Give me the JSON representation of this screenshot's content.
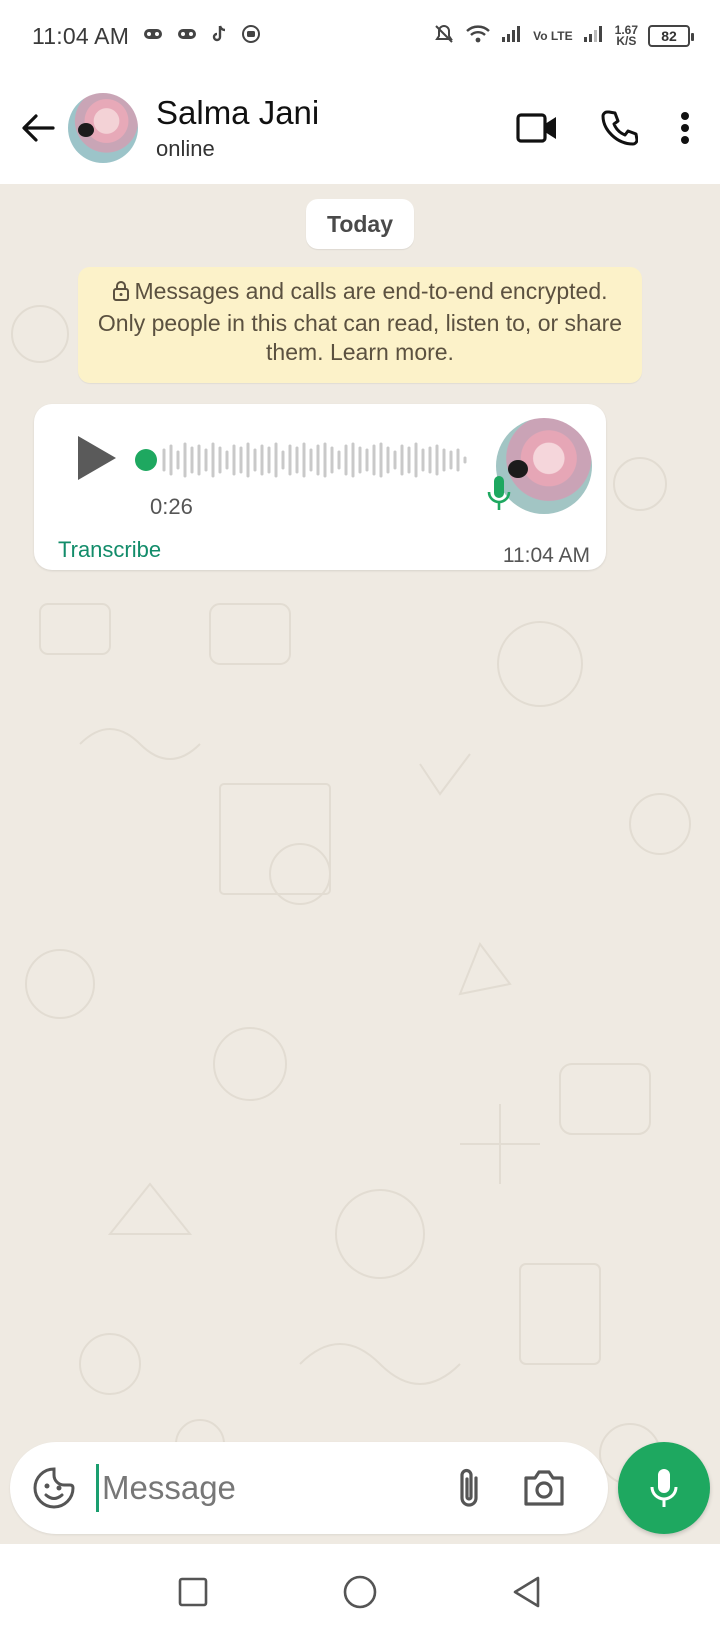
{
  "status_bar": {
    "time": "11:04 AM",
    "network_type": "Vo LTE",
    "speed_value": "1.67",
    "speed_unit": "K/S",
    "battery": "82",
    "icons": [
      "controller-icon",
      "controller-icon",
      "tiktok-icon",
      "app-icon",
      "mute-icon",
      "wifi-icon",
      "signal-icon",
      "signal-icon"
    ]
  },
  "header": {
    "contact_name": "Salma Jani",
    "contact_status": "online",
    "icons": [
      "back-arrow-icon",
      "video-call-icon",
      "phone-icon",
      "more-vert-icon"
    ]
  },
  "chat": {
    "date_chip": "Today",
    "encryption_notice": "Messages and calls are end-to-end encrypted. Only people in this chat can read, listen to, or share them. Learn more.",
    "voice_message": {
      "duration": "0:26",
      "transcribe_label": "Transcribe",
      "time": "11:04 AM",
      "progress": 0
    }
  },
  "input": {
    "placeholder": "Message",
    "value": ""
  },
  "colors": {
    "accent_green": "#1ea860",
    "chat_background": "#efeae2",
    "notice_background": "#fcf2c9",
    "link_green": "#128c6a"
  }
}
